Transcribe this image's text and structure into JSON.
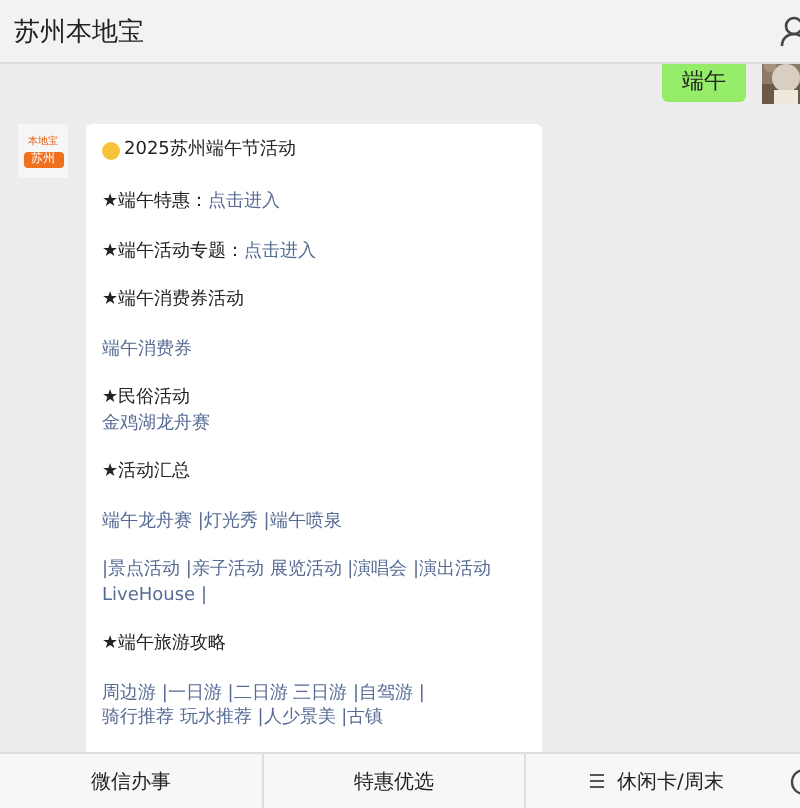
{
  "header": {
    "title": "苏州本地宝"
  },
  "sent_message": {
    "text": "端午"
  },
  "account_logo": {
    "top": "本地宝",
    "badge": "苏州"
  },
  "message": {
    "title": "2025苏州端午节活动",
    "paragraphs": [
      [
        {
          "kind": "text",
          "text": "★端午特惠："
        },
        {
          "kind": "link",
          "text": "点击进入"
        }
      ],
      [
        {
          "kind": "text",
          "text": "★端午活动专题："
        },
        {
          "kind": "link",
          "text": "点击进入"
        }
      ],
      [
        {
          "kind": "text",
          "text": "★端午消费券活动"
        }
      ],
      [
        {
          "kind": "link",
          "text": "端午消费券"
        }
      ],
      [
        {
          "kind": "text",
          "text": "★民俗活动"
        },
        {
          "kind": "break"
        },
        {
          "kind": "link",
          "text": "金鸡湖龙舟赛"
        }
      ],
      [
        {
          "kind": "text",
          "text": "★活动汇总"
        }
      ],
      [
        {
          "kind": "link",
          "text": "端午龙舟赛 |灯光秀 |端午喷泉"
        }
      ],
      [
        {
          "kind": "link",
          "text": "|景点活动 |亲子活动 展览活动 |演唱会 |演出活动"
        },
        {
          "kind": "break"
        },
        {
          "kind": "link",
          "text": "LiveHouse |"
        }
      ],
      [
        {
          "kind": "text",
          "text": "★端午旅游攻略"
        }
      ],
      [
        {
          "kind": "link",
          "text": "周边游 |一日游 |二日游 三日游 |自驾游 |"
        },
        {
          "kind": "break"
        },
        {
          "kind": "link",
          "text": "骑行推荐 玩水推荐 |人少景美 |古镇"
        }
      ]
    ]
  },
  "menu": [
    {
      "label": "微信办事",
      "has_menu_icon": false
    },
    {
      "label": "特惠优选",
      "has_menu_icon": false
    },
    {
      "label": "休闲卡/周末",
      "has_menu_icon": true
    }
  ]
}
